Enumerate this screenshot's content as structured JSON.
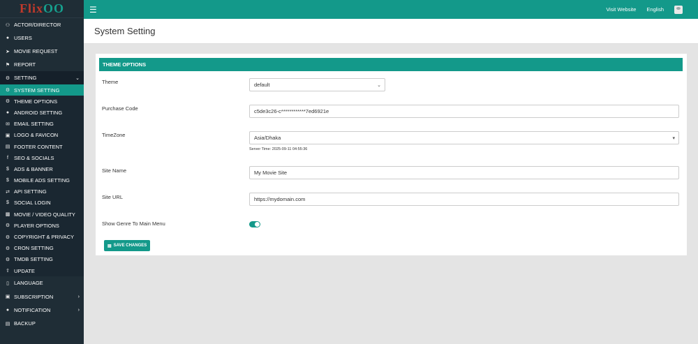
{
  "logo": {
    "text": "Flix",
    "mark": "OO"
  },
  "topbar": {
    "visit_website": "Visit Website",
    "language": "English"
  },
  "page": {
    "title": "System Setting"
  },
  "sidebar": {
    "items_top": [
      {
        "label": "ACTOR/DIRECTOR",
        "icon": "users-icon"
      },
      {
        "label": "USERS",
        "icon": "user-icon"
      },
      {
        "label": "MOVIE REQUEST",
        "icon": "paper-plane-icon"
      },
      {
        "label": "REPORT",
        "icon": "flag-icon"
      },
      {
        "label": "SETTING",
        "icon": "cogs-icon"
      }
    ],
    "setting_sub": [
      {
        "label": "SYSTEM SETTING",
        "icon": "gear-icon"
      },
      {
        "label": "THEME OPTIONS",
        "icon": "gear-icon"
      },
      {
        "label": "ANDROID SETTING",
        "icon": "android-icon"
      },
      {
        "label": "EMAIL SETTING",
        "icon": "envelope-icon"
      },
      {
        "label": "LOGO & FAVICON",
        "icon": "image-icon"
      },
      {
        "label": "FOOTER CONTENT",
        "icon": "footer-icon"
      },
      {
        "label": "SEO & SOCIALS",
        "icon": "facebook-icon"
      },
      {
        "label": "ADS & BANNER",
        "icon": "dollar-icon"
      },
      {
        "label": "MOBILE ADS SETTING",
        "icon": "dollar-icon"
      },
      {
        "label": "API SETTING",
        "icon": "exchange-icon"
      },
      {
        "label": "SOCIAL LOGIN",
        "icon": "dollar-icon"
      },
      {
        "label": "MOVIE / VIDEO QUALITY",
        "icon": "signal-icon"
      },
      {
        "label": "PLAYER OPTIONS",
        "icon": "gear-icon"
      },
      {
        "label": "COPYRIGHT & PRIVACY",
        "icon": "gear-icon"
      },
      {
        "label": "CRON SETTING",
        "icon": "gear-icon"
      },
      {
        "label": "TMDB SETTING",
        "icon": "gear-icon"
      },
      {
        "label": "UPDATE",
        "icon": "upload-icon"
      }
    ],
    "items_bottom": [
      {
        "label": "LANGUAGE",
        "icon": "language-icon"
      },
      {
        "label": "SUBSCRIPTION",
        "icon": "subscription-icon"
      },
      {
        "label": "NOTIFICATION",
        "icon": "bell-icon"
      },
      {
        "label": "BACKUP",
        "icon": "database-icon"
      }
    ]
  },
  "form": {
    "header": "THEME OPTIONS",
    "theme": {
      "label": "Theme",
      "value": "default"
    },
    "purchase_code": {
      "label": "Purchase Code",
      "value": "c5de3c26-c************7ed6921e"
    },
    "timezone": {
      "label": "TimeZone",
      "value": "Asia/Dhaka",
      "server_time": "Server Time: 2025-09-11 04:55:36"
    },
    "site_name": {
      "label": "Site Name",
      "value": "My Movie Site"
    },
    "site_url": {
      "label": "Site URL",
      "value": "https://mydomain.com"
    },
    "show_genre": {
      "label": "Show Genre To Main Menu",
      "enabled": true
    },
    "save_label": "SAVE CHANGES"
  },
  "colors": {
    "accent": "#13998a",
    "sidebar": "#1f2d36"
  }
}
